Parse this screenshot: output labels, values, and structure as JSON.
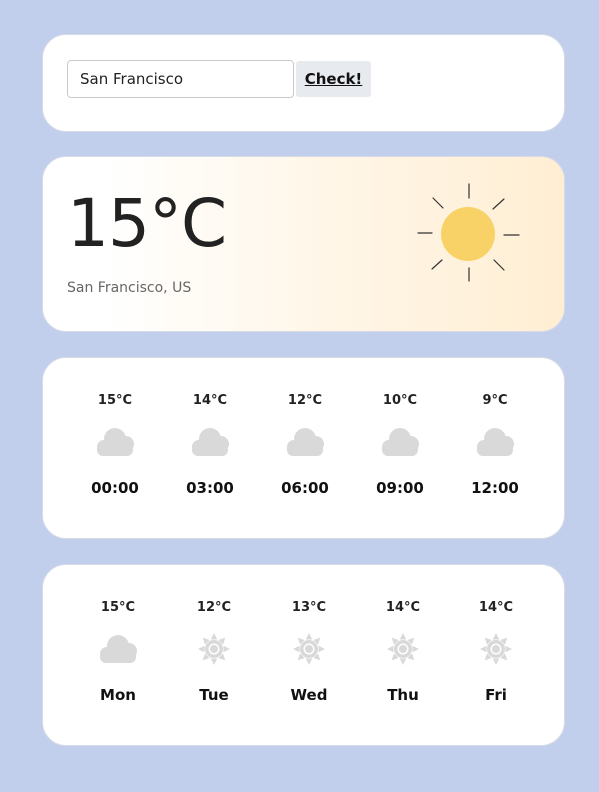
{
  "search": {
    "value": "San Francisco",
    "placeholder": "",
    "button_label": "Check!"
  },
  "current": {
    "temperature": "15°C",
    "location": "San Francisco, US",
    "icon": "sun-icon"
  },
  "hourly": [
    {
      "temp": "15°C",
      "icon": "cloud-icon",
      "time": "00:00"
    },
    {
      "temp": "14°C",
      "icon": "cloud-icon",
      "time": "03:00"
    },
    {
      "temp": "12°C",
      "icon": "cloud-icon",
      "time": "06:00"
    },
    {
      "temp": "10°C",
      "icon": "cloud-icon",
      "time": "09:00"
    },
    {
      "temp": "9°C",
      "icon": "cloud-icon",
      "time": "12:00"
    }
  ],
  "daily": [
    {
      "temp": "15°C",
      "icon": "cloud-icon",
      "day": "Mon"
    },
    {
      "temp": "12°C",
      "icon": "sun-icon",
      "day": "Tue"
    },
    {
      "temp": "13°C",
      "icon": "sun-icon",
      "day": "Wed"
    },
    {
      "temp": "14°C",
      "icon": "sun-icon",
      "day": "Thu"
    },
    {
      "temp": "14°C",
      "icon": "sun-icon",
      "day": "Fri"
    }
  ],
  "colors": {
    "background": "#c2cfec",
    "sun": "#f9d267",
    "icon_gray": "#d9d9d9"
  }
}
